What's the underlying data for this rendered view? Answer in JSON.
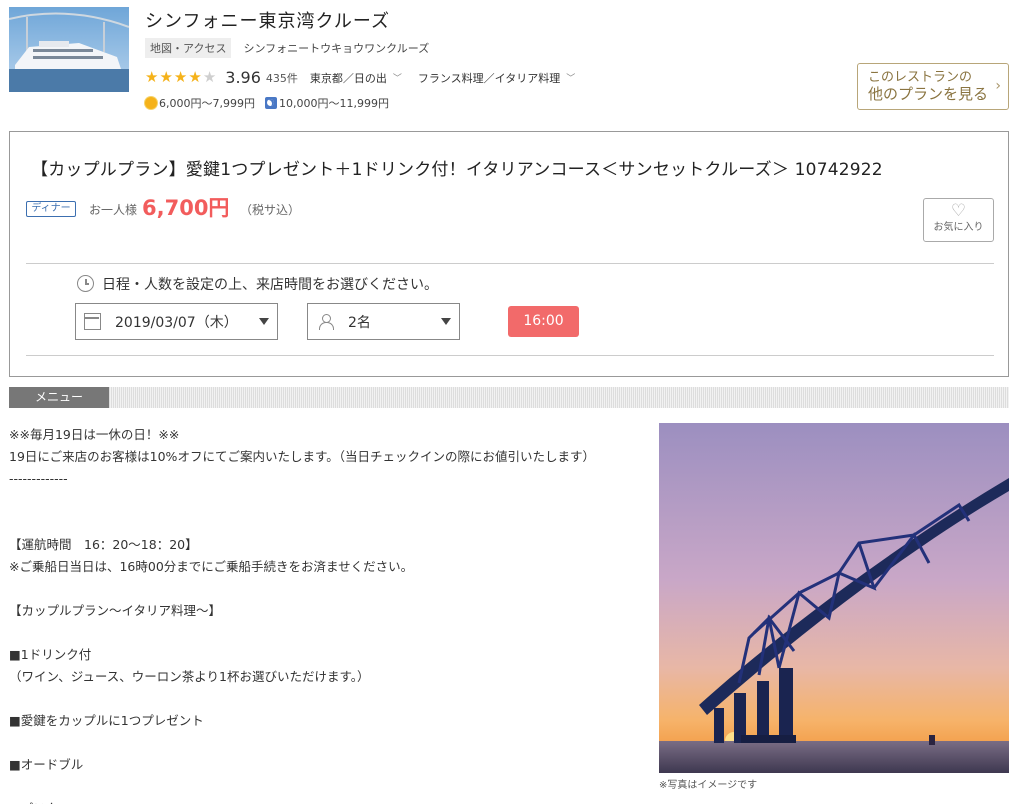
{
  "restaurant": {
    "name": "シンフォニー東京湾クルーズ",
    "map_tag": "地図・アクセス",
    "kana": "シンフォニートウキョウワンクルーズ",
    "rating": 3.96,
    "rating_text": "3.96",
    "stars_filled": 4,
    "review_count": "435件",
    "location": "東京都／日の出",
    "cuisine": "フランス料理／イタリア料理",
    "lunch_price": "6,000円～7,999円",
    "dinner_price": "10,000円～11,999円",
    "other_plans_line1": "このレストランの",
    "other_plans_line2": "他のプランを見る"
  },
  "plan": {
    "title": "【カップルプラン】愛鍵1つプレゼント＋1ドリンク付！イタリアンコース＜サンセットクルーズ＞ 10742922",
    "tag": "ディナー",
    "per_person": "お一人様",
    "price": "6,700円",
    "tax": "（税サ込）",
    "favorite": "お気に入り",
    "instruction": "日程・人数を設定の上、来店時間をお選びください。",
    "date": "2019/03/07（木）",
    "people": "2名",
    "time": "16:00"
  },
  "menu": {
    "tab": "メニュー",
    "lines": [
      "※※毎月19日は一休の日！※※",
      "19日にご来店のお客様は10%オフにてご案内いたします。（当日チェックインの際にお値引いたします）",
      "-------------",
      "",
      "",
      "【運航時間　16：20～18：20】",
      "※ご乗船日当日は、16時00分までにご乗船手続きをお済ませください。",
      "",
      "【カップルプラン～イタリア料理～】",
      "",
      "■1ドリンク付",
      "（ワイン、ジュース、ウーロン茶より1杯お選びいただけます。）",
      "",
      "■愛鍵をカップルに1つプレゼント",
      "",
      "■オードブル",
      "",
      "■パスタ"
    ],
    "photo_caption": "※写真はイメージです"
  },
  "colors": {
    "accent_red": "#f26a6a",
    "price_red": "#f25c5c",
    "gold": "#b8a679",
    "star": "#f5b21a",
    "dinner_blue": "#3c6fb0"
  }
}
